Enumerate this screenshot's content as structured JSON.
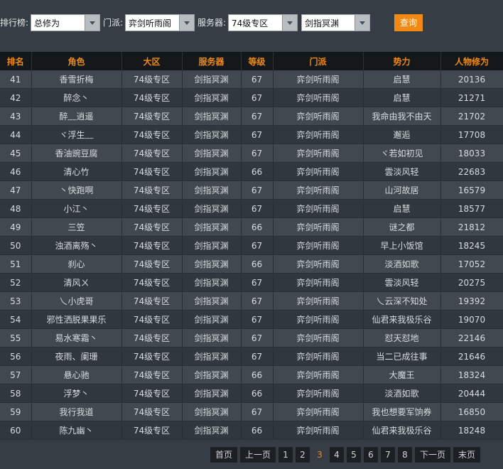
{
  "filters": {
    "rank_label": "排行榜:",
    "rank_value": "总修为",
    "school_label": "门派:",
    "school_value": "弈剑听雨阁",
    "server_label": "服务器:",
    "server_value": "74级专区",
    "subserver_value": "剑指冥渊",
    "query_label": "查询"
  },
  "table": {
    "headers": [
      "排名",
      "角色",
      "大区",
      "服务器",
      "等级",
      "门派",
      "势力",
      "人物修为"
    ],
    "rows": [
      [
        "41",
        "香雪折梅",
        "74级专区",
        "剑指冥渊",
        "67",
        "弈剑听雨阁",
        "启慧",
        "20136"
      ],
      [
        "42",
        "醉念丶",
        "74级专区",
        "剑指冥渊",
        "67",
        "弈剑听雨阁",
        "启慧",
        "21271"
      ],
      [
        "43",
        "醉﹏逍遥",
        "74级专区",
        "剑指冥渊",
        "67",
        "弈剑听雨阁",
        "我命由我不由天",
        "21702"
      ],
      [
        "44",
        "ヾ浮生﹏",
        "74级专区",
        "剑指冥渊",
        "67",
        "弈剑听雨阁",
        "邂逅",
        "17708"
      ],
      [
        "45",
        "香油豌豆腐",
        "74级专区",
        "剑指冥渊",
        "67",
        "弈剑听雨阁",
        "ヾ若如初见",
        "18033"
      ],
      [
        "46",
        "清心竹",
        "74级专区",
        "剑指冥渊",
        "66",
        "弈剑听雨阁",
        "雲淡风轻",
        "22683"
      ],
      [
        "47",
        "丶快跑啊",
        "74级专区",
        "剑指冥渊",
        "67",
        "弈剑听雨阁",
        "山河故居",
        "16579"
      ],
      [
        "48",
        "小江丶",
        "74级专区",
        "剑指冥渊",
        "67",
        "弈剑听雨阁",
        "启慧",
        "18577"
      ],
      [
        "49",
        "三笠",
        "74级专区",
        "剑指冥渊",
        "66",
        "弈剑听雨阁",
        "谜之都",
        "21812"
      ],
      [
        "50",
        "浊酒离殇丶",
        "74级专区",
        "剑指冥渊",
        "67",
        "弈剑听雨阁",
        "早上小饭馆",
        "18245"
      ],
      [
        "51",
        "刹心",
        "74级专区",
        "剑指冥渊",
        "66",
        "弈剑听雨阁",
        "淡酒如歌",
        "17052"
      ],
      [
        "52",
        "清风ㄨ",
        "74级专区",
        "剑指冥渊",
        "67",
        "弈剑听雨阁",
        "雲淡风轻",
        "20275"
      ],
      [
        "53",
        "乀小虎哥",
        "74级专区",
        "剑指冥渊",
        "67",
        "弈剑听雨阁",
        "乀云深不知处",
        "19392"
      ],
      [
        "54",
        "邪性洒脱果果乐",
        "74级专区",
        "剑指冥渊",
        "67",
        "弈剑听雨阁",
        "仙君来我极乐谷",
        "19070"
      ],
      [
        "55",
        "易水寒霜丶",
        "74级专区",
        "剑指冥渊",
        "67",
        "弈剑听雨阁",
        "怼天怼地",
        "22146"
      ],
      [
        "56",
        "夜雨、阑珊",
        "74级专区",
        "剑指冥渊",
        "67",
        "弈剑听雨阁",
        "当二已成往事",
        "21646"
      ],
      [
        "57",
        "悬心驰",
        "74级专区",
        "剑指冥渊",
        "66",
        "弈剑听雨阁",
        "大魔王",
        "18324"
      ],
      [
        "58",
        "浮梦丶",
        "74级专区",
        "剑指冥渊",
        "66",
        "弈剑听雨阁",
        "淡酒如歌",
        "20444"
      ],
      [
        "59",
        "我行我道",
        "74级专区",
        "剑指冥渊",
        "67",
        "弈剑听雨阁",
        "我也想要军饷券",
        "16850"
      ],
      [
        "60",
        "陈九幽丶",
        "74级专区",
        "剑指冥渊",
        "66",
        "弈剑听雨阁",
        "仙君来我极乐谷",
        "18248"
      ]
    ]
  },
  "pagination": {
    "first": "首页",
    "prev": "上一页",
    "pages": [
      "1",
      "2",
      "3",
      "4",
      "5",
      "6",
      "7",
      "8"
    ],
    "current_page": "3",
    "next": "下一页",
    "last": "末页"
  },
  "colors": {
    "accent": "#f08a14",
    "background": "#363d45",
    "header_bg": "#15181b",
    "row_light": "#42484f",
    "row_dark": "#31373e"
  }
}
